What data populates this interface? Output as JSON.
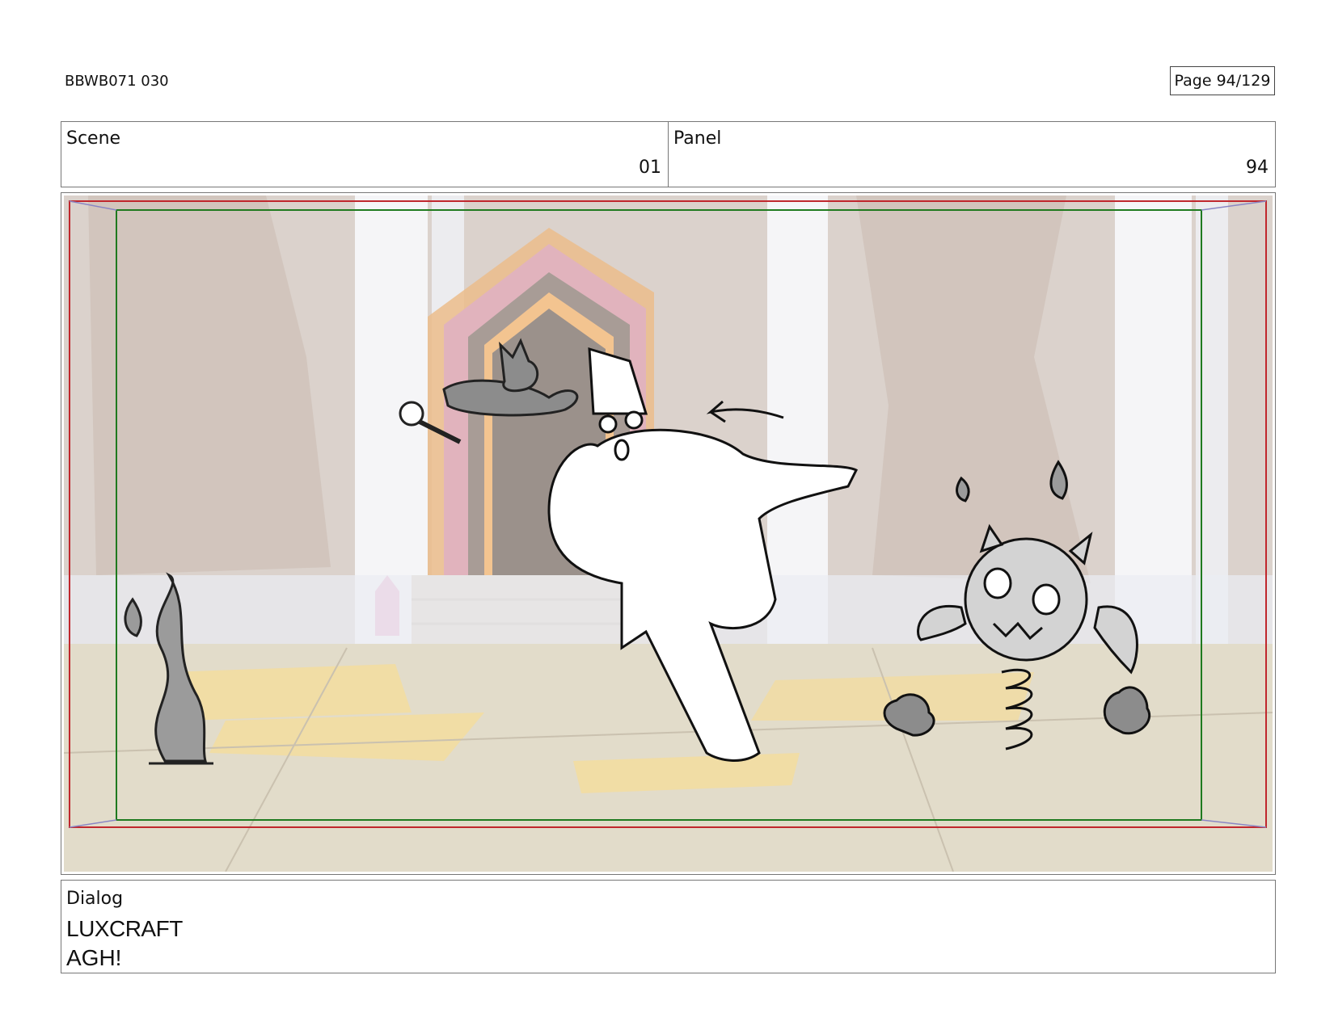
{
  "header": {
    "doc_id": "BBWB071 030",
    "page_label": "Page 94/129"
  },
  "info": {
    "scene_label": "Scene",
    "scene_value": "01",
    "panel_label": "Panel",
    "panel_value": "94"
  },
  "dialog": {
    "label": "Dialog",
    "character": "LUXCRAFT",
    "line": "AGH!"
  },
  "colors": {
    "safe_frame_red": "#c0272d",
    "title_safe_green": "#1f7a1f"
  }
}
